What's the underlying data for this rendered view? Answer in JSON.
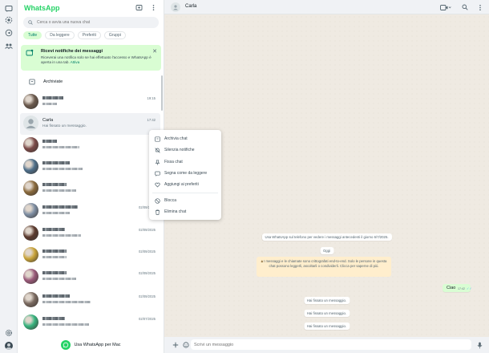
{
  "app": {
    "brand": "WhatsApp"
  },
  "search": {
    "placeholder": "Cerca o avvia una nuova chat"
  },
  "filters": [
    {
      "label": "Tutte",
      "active": true
    },
    {
      "label": "Da leggere",
      "active": false
    },
    {
      "label": "Preferiti",
      "active": false
    },
    {
      "label": "Gruppi",
      "active": false
    }
  ],
  "banner": {
    "title": "Ricevi notifiche dei messaggi",
    "text": "Riceverai una notifica solo se hai effettuato l'accesso e WhatsApp è aperta in una tab.",
    "link": "Attiva"
  },
  "archived": {
    "label": "Archiviate"
  },
  "chats": [
    {
      "name": "",
      "preview": "",
      "time": "19:15",
      "avatar_color": "#6b5a4e"
    },
    {
      "name": "Carla",
      "preview": "Hai fissato un messaggio.",
      "time": "17:42",
      "avatar_color": "#dfe5e7",
      "selected": true
    },
    {
      "name": "",
      "preview": "",
      "time": "",
      "avatar_color": "#7b4a48"
    },
    {
      "name": "",
      "preview": "",
      "time": "",
      "avatar_color": "#4e6f8a"
    },
    {
      "name": "",
      "preview": "",
      "time": "",
      "avatar_color": "#8a6a3c"
    },
    {
      "name": "",
      "preview": "",
      "time": "02/09/2025",
      "avatar_color": "#7e8ea3"
    },
    {
      "name": "",
      "preview": "",
      "time": "02/09/2025",
      "avatar_color": "#5b3a2e"
    },
    {
      "name": "",
      "preview": "",
      "time": "02/09/2025",
      "avatar_color": "#c9a43a"
    },
    {
      "name": "",
      "preview": "",
      "time": "02/09/2025",
      "avatar_color": "#9a5a7a"
    },
    {
      "name": "",
      "preview": "",
      "time": "02/09/2025",
      "avatar_color": "#7a6a60"
    },
    {
      "name": "",
      "preview": "",
      "time": "02/07/2025",
      "avatar_color": "#36b37e"
    }
  ],
  "cta": {
    "label": "Usa WhatsApp per Mac"
  },
  "header": {
    "contact_name": "Carla"
  },
  "context_menu": [
    {
      "label": "Archivia chat",
      "icon": "archive-icon"
    },
    {
      "label": "Silenzia notifiche",
      "icon": "mute-icon"
    },
    {
      "label": "Fissa chat",
      "icon": "pin-icon"
    },
    {
      "label": "Segna come da leggere",
      "icon": "mark-unread-icon"
    },
    {
      "label": "Aggiungi ai preferiti",
      "icon": "heart-icon"
    },
    {
      "label": "Blocca",
      "icon": "block-icon"
    },
    {
      "label": "Elimina chat",
      "icon": "trash-icon"
    }
  ],
  "conversation": {
    "history_notice": "Usa WhatsApp sul telefono per vedere i messaggi antecedenti il giorno 6/7/2025.",
    "date_divider": "Oggi",
    "encryption_notice": "I messaggi e le chiamate sono crittografati end-to-end. Solo le persone in questa chat possono leggerli, ascoltarli o condividerli. Clicca per saperne di più.",
    "outgoing": {
      "text": "Ciao",
      "time": "17:42"
    },
    "system_messages": [
      "Hai fissato un messaggio.",
      "Hai fissato un messaggio.",
      "Hai fissato un messaggio."
    ]
  },
  "composer": {
    "placeholder": "Scrivi un messaggio"
  },
  "colors": {
    "accent": "#25d366",
    "bubble_out": "#d9fdd3",
    "chat_bg": "#efeae2"
  }
}
